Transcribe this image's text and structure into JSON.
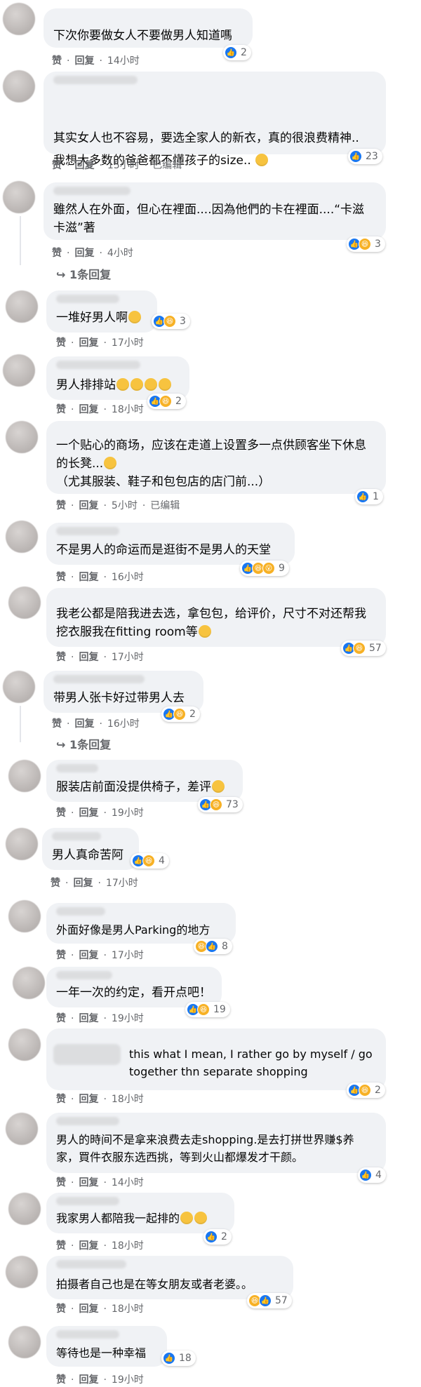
{
  "labels": {
    "like": "赞",
    "reply": "回复",
    "edited": "已编辑"
  },
  "comments": [
    {
      "text": "下次你要做女人不要做男人知道嗎",
      "time": "14小时",
      "count": "2"
    },
    {
      "text": "其实女人也不容易，要选全家人的新衣，真的很浪费精神..",
      "text2": "我想大多数的爸爸都不懂孩子的size..",
      "time": "15小时",
      "edited": true,
      "count": "23"
    },
    {
      "text": "雖然人在外面，但心在裡面....因為他們的卡在裡面....“卡滋卡滋”著",
      "time": "4小时",
      "count": "3",
      "replies": "1条回复"
    },
    {
      "text": "一堆好男人啊",
      "time": "17小时",
      "count": "3"
    },
    {
      "text": "男人排排站",
      "time": "18小时",
      "count": "2"
    },
    {
      "text": "一个贴心的商场，应该在走道上设置多一点供顾客坐下休息的长凳...",
      "text2": "（尤其服装、鞋子和包包店的店门前...）",
      "time": "5小时",
      "edited": true,
      "count": "1"
    },
    {
      "text": "不是男人的命运而是逛街不是男人的天堂",
      "time": "16小时",
      "count": "9"
    },
    {
      "text": "我老公都是陪我进去选，拿包包，给评价，尺寸不对还帮我挖衣服我在fitting room等",
      "time": "17小时",
      "count": "57"
    },
    {
      "text": "带男人张卡好过带男人去",
      "time": "16小时",
      "count": "2",
      "replies": "1条回复"
    },
    {
      "text": "服装店前面没提供椅子，差评",
      "time": "19小时",
      "count": "73"
    },
    {
      "text": "男人真命苦阿",
      "time": "17小时",
      "count": "4"
    },
    {
      "text": "外面好像是男人Parking的地方",
      "time": "17小时",
      "count": "8"
    },
    {
      "text": "一年一次的约定，看开点吧！",
      "time": "19小时",
      "count": "19"
    },
    {
      "text": "this what I mean, I rather go by myself / go together thn separate shopping",
      "time": "18小时",
      "count": "2"
    },
    {
      "text": "男人的時间不是拿来浪费去走shopping.是去打拼世界赚$养家，買件衣服东选西挑，等到火山都爆发才干颜。",
      "time": "14小时",
      "count": "4"
    },
    {
      "text": "我家男人都陪我一起排的",
      "time": "18小时",
      "count": "2"
    },
    {
      "text": "拍摄者自己也是在等女朋友或者老婆。。",
      "time": "18小时",
      "count": "57"
    },
    {
      "text": "等待也是一种幸福",
      "time": "19小时",
      "count": "18"
    }
  ]
}
